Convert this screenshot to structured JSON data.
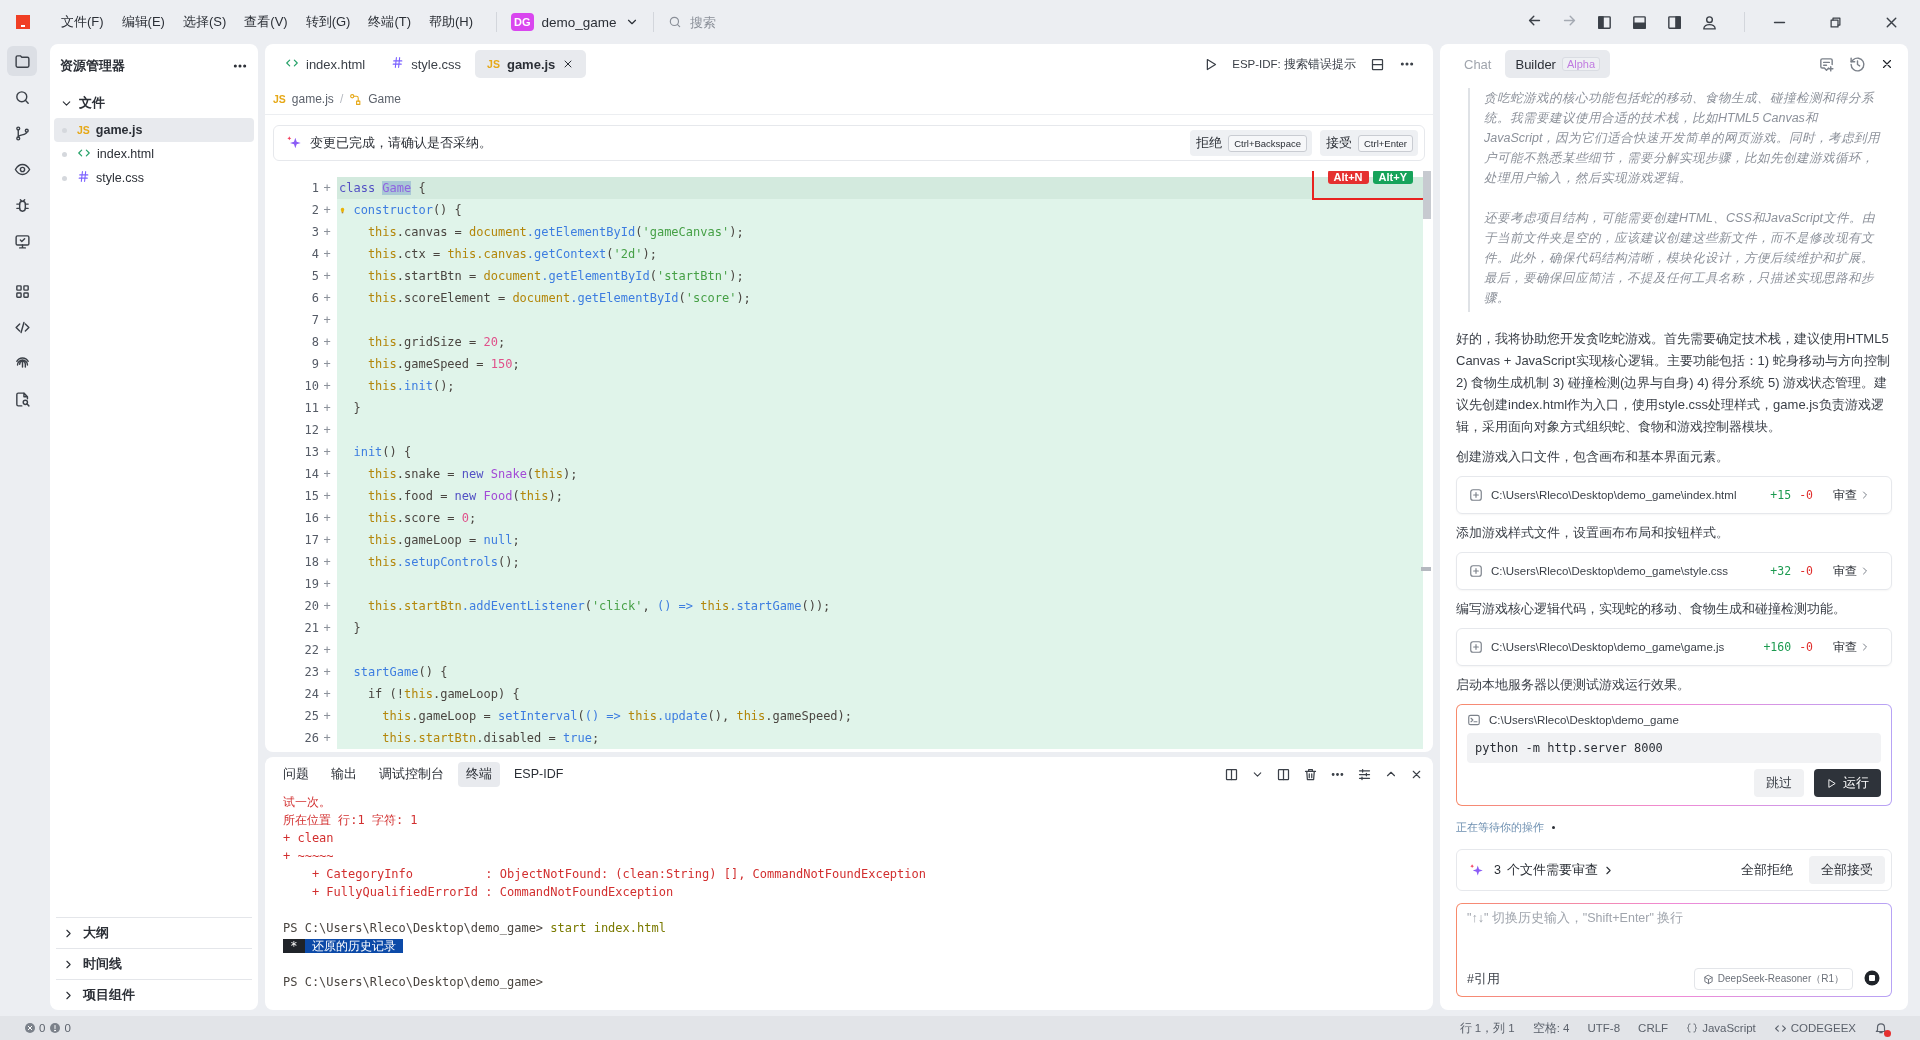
{
  "menu_bar": {
    "items": [
      "文件(F)",
      "编辑(E)",
      "选择(S)",
      "查看(V)",
      "转到(G)",
      "终端(T)",
      "帮助(H)"
    ],
    "project": {
      "badge": "DG",
      "name": "demo_game"
    },
    "search": {
      "placeholder": "搜索"
    },
    "history": {
      "back_enabled": true,
      "forward_enabled": false
    }
  },
  "activity_bar": [
    {
      "selected": true
    },
    {
      "selected": false
    },
    {
      "selected": false
    },
    {
      "selected": false
    },
    {
      "selected": false
    },
    {
      "selected": false
    },
    {
      "selected": false
    },
    {
      "selected": false
    },
    {
      "selected": false
    },
    {
      "selected": false
    }
  ],
  "explorer": {
    "title": "资源管理器",
    "files_section": {
      "label": "文件",
      "expanded": true,
      "files": [
        {
          "name": "game.js",
          "kind": "js",
          "badge": "JS",
          "selected": true
        },
        {
          "name": "index.html",
          "kind": "html",
          "selected": false
        },
        {
          "name": "style.css",
          "kind": "css",
          "selected": false
        }
      ]
    },
    "sections": [
      {
        "label": "大纲",
        "expanded": false
      },
      {
        "label": "时间线",
        "expanded": false
      },
      {
        "label": "项目组件",
        "expanded": false
      }
    ]
  },
  "editor": {
    "tabs": [
      {
        "label": "index.html",
        "kind": "html",
        "selected": false
      },
      {
        "label": "style.css",
        "kind": "css",
        "selected": false
      },
      {
        "label": "game.js",
        "kind": "js",
        "badge": "JS",
        "selected": true
      }
    ],
    "toolbar_label": "ESP-IDF: 搜索错误提示",
    "breadcrumb": {
      "file_badge": "JS",
      "file": "game.js",
      "separator": "/",
      "symbol": "Game"
    },
    "diff_banner": {
      "message": "变更已完成，请确认是否采纳。",
      "reject": {
        "label": "拒绝",
        "shortcut": "Ctrl+Backspace"
      },
      "accept": {
        "label": "接受",
        "shortcut": "Ctrl+Enter"
      }
    },
    "shortcut_badges": [
      {
        "text": "Alt+N",
        "kind": "reject"
      },
      {
        "text": "Alt+Y",
        "kind": "accept"
      }
    ],
    "lines": [
      {
        "num": "1",
        "marker": "+",
        "current": true,
        "hint": false,
        "tokens": [
          {
            "kind": "kw",
            "text": "class "
          },
          {
            "kind": "sel",
            "text": "Game"
          },
          {
            "kind": "p",
            "text": " {"
          }
        ]
      },
      {
        "num": "2",
        "marker": "+",
        "current": false,
        "hint": true,
        "tokens": [
          {
            "kind": "fn",
            "text": " constructor"
          },
          {
            "kind": "p",
            "text": "() {"
          }
        ]
      },
      {
        "num": "3",
        "marker": "+",
        "current": false,
        "hint": false,
        "tokens": [
          {
            "kind": "th",
            "text": "    this"
          },
          {
            "kind": "p",
            "text": ".canvas = "
          },
          {
            "kind": "th",
            "text": "document"
          },
          {
            "kind": "fn",
            "text": ".getElementById"
          },
          {
            "kind": "p",
            "text": "("
          },
          {
            "kind": "str",
            "text": "'gameCanvas'"
          },
          {
            "kind": "p",
            "text": ");"
          }
        ]
      },
      {
        "num": "4",
        "marker": "+",
        "current": false,
        "hint": false,
        "tokens": [
          {
            "kind": "th",
            "text": "    this"
          },
          {
            "kind": "p",
            "text": ".ctx = "
          },
          {
            "kind": "th",
            "text": "this.canvas"
          },
          {
            "kind": "fn",
            "text": ".getContext"
          },
          {
            "kind": "p",
            "text": "("
          },
          {
            "kind": "str",
            "text": "'2d'"
          },
          {
            "kind": "p",
            "text": ");"
          }
        ]
      },
      {
        "num": "5",
        "marker": "+",
        "current": false,
        "hint": false,
        "tokens": [
          {
            "kind": "th",
            "text": "    this"
          },
          {
            "kind": "p",
            "text": ".startBtn = "
          },
          {
            "kind": "th",
            "text": "document"
          },
          {
            "kind": "fn",
            "text": ".getElementById"
          },
          {
            "kind": "p",
            "text": "("
          },
          {
            "kind": "str",
            "text": "'startBtn'"
          },
          {
            "kind": "p",
            "text": ");"
          }
        ]
      },
      {
        "num": "6",
        "marker": "+",
        "current": false,
        "hint": false,
        "tokens": [
          {
            "kind": "th",
            "text": "    this"
          },
          {
            "kind": "p",
            "text": ".scoreElement = "
          },
          {
            "kind": "th",
            "text": "document"
          },
          {
            "kind": "fn",
            "text": ".getElementById"
          },
          {
            "kind": "p",
            "text": "("
          },
          {
            "kind": "str",
            "text": "'score'"
          },
          {
            "kind": "p",
            "text": ");"
          }
        ]
      },
      {
        "num": "7",
        "marker": "+",
        "current": false,
        "hint": false
      },
      {
        "num": "8",
        "marker": "+",
        "current": false,
        "hint": false,
        "tokens": [
          {
            "kind": "th",
            "text": "    this"
          },
          {
            "kind": "p",
            "text": ".gridSize = "
          },
          {
            "kind": "num",
            "text": "20"
          },
          {
            "kind": "p",
            "text": ";"
          }
        ]
      },
      {
        "num": "9",
        "marker": "+",
        "current": false,
        "hint": false,
        "tokens": [
          {
            "kind": "th",
            "text": "    this"
          },
          {
            "kind": "p",
            "text": ".gameSpeed = "
          },
          {
            "kind": "num",
            "text": "150"
          },
          {
            "kind": "p",
            "text": ";"
          }
        ]
      },
      {
        "num": "10",
        "marker": "+",
        "current": false,
        "hint": false,
        "tokens": [
          {
            "kind": "th",
            "text": "    this"
          },
          {
            "kind": "fn",
            "text": ".init"
          },
          {
            "kind": "p",
            "text": "();"
          }
        ]
      },
      {
        "num": "11",
        "marker": "+",
        "current": false,
        "hint": false,
        "tokens": [
          {
            "kind": "p",
            "text": "  }"
          }
        ]
      },
      {
        "num": "12",
        "marker": "+",
        "current": false,
        "hint": false
      },
      {
        "num": "13",
        "marker": "+",
        "current": false,
        "hint": false,
        "tokens": [
          {
            "kind": "fn",
            "text": "  init"
          },
          {
            "kind": "p",
            "text": "() {"
          }
        ]
      },
      {
        "num": "14",
        "marker": "+",
        "current": false,
        "hint": false,
        "tokens": [
          {
            "kind": "th",
            "text": "    this"
          },
          {
            "kind": "p",
            "text": ".snake = "
          },
          {
            "kind": "kw",
            "text": "new "
          },
          {
            "kind": "cls",
            "text": "Snake"
          },
          {
            "kind": "p",
            "text": "("
          },
          {
            "kind": "th",
            "text": "this"
          },
          {
            "kind": "p",
            "text": ");"
          }
        ]
      },
      {
        "num": "15",
        "marker": "+",
        "current": false,
        "hint": false,
        "tokens": [
          {
            "kind": "th",
            "text": "    this"
          },
          {
            "kind": "p",
            "text": ".food = "
          },
          {
            "kind": "kw",
            "text": "new "
          },
          {
            "kind": "cls",
            "text": "Food"
          },
          {
            "kind": "p",
            "text": "("
          },
          {
            "kind": "th",
            "text": "this"
          },
          {
            "kind": "p",
            "text": ");"
          }
        ]
      },
      {
        "num": "16",
        "marker": "+",
        "current": false,
        "hint": false,
        "tokens": [
          {
            "kind": "th",
            "text": "    this"
          },
          {
            "kind": "p",
            "text": ".score = "
          },
          {
            "kind": "num",
            "text": "0"
          },
          {
            "kind": "p",
            "text": ";"
          }
        ]
      },
      {
        "num": "17",
        "marker": "+",
        "current": false,
        "hint": false,
        "tokens": [
          {
            "kind": "th",
            "text": "    this"
          },
          {
            "kind": "p",
            "text": ".gameLoop = "
          },
          {
            "kind": "lit",
            "text": "null"
          },
          {
            "kind": "p",
            "text": ";"
          }
        ]
      },
      {
        "num": "18",
        "marker": "+",
        "current": false,
        "hint": false,
        "tokens": [
          {
            "kind": "th",
            "text": "    this"
          },
          {
            "kind": "fn",
            "text": ".setupControls"
          },
          {
            "kind": "p",
            "text": "();"
          }
        ]
      },
      {
        "num": "19",
        "marker": "+",
        "current": false,
        "hint": false
      },
      {
        "num": "20",
        "marker": "+",
        "current": false,
        "hint": false,
        "tokens": [
          {
            "kind": "th",
            "text": "    this.startBtn"
          },
          {
            "kind": "fn",
            "text": ".addEventListener"
          },
          {
            "kind": "p",
            "text": "("
          },
          {
            "kind": "str",
            "text": "'click'"
          },
          {
            "kind": "p",
            "text": ", "
          },
          {
            "kind": "lit",
            "text": "() => "
          },
          {
            "kind": "th",
            "text": "this"
          },
          {
            "kind": "fn",
            "text": ".startGame"
          },
          {
            "kind": "p",
            "text": "());"
          }
        ]
      },
      {
        "num": "21",
        "marker": "+",
        "current": false,
        "hint": false,
        "tokens": [
          {
            "kind": "p",
            "text": "  }"
          }
        ]
      },
      {
        "num": "22",
        "marker": "+",
        "current": false,
        "hint": false
      },
      {
        "num": "23",
        "marker": "+",
        "current": false,
        "hint": false,
        "tokens": [
          {
            "kind": "fn",
            "text": "  startGame"
          },
          {
            "kind": "p",
            "text": "() {"
          }
        ]
      },
      {
        "num": "24",
        "marker": "+",
        "current": false,
        "hint": false,
        "tokens": [
          {
            "kind": "p",
            "text": "    if (!"
          },
          {
            "kind": "th",
            "text": "this"
          },
          {
            "kind": "p",
            "text": ".gameLoop) {"
          }
        ]
      },
      {
        "num": "25",
        "marker": "+",
        "current": false,
        "hint": false,
        "tokens": [
          {
            "kind": "th",
            "text": "      this"
          },
          {
            "kind": "p",
            "text": ".gameLoop = "
          },
          {
            "kind": "fn",
            "text": "setInterval"
          },
          {
            "kind": "p",
            "text": "("
          },
          {
            "kind": "lit",
            "text": "() => "
          },
          {
            "kind": "th",
            "text": "this"
          },
          {
            "kind": "fn",
            "text": ".update"
          },
          {
            "kind": "p",
            "text": "(), "
          },
          {
            "kind": "th",
            "text": "this"
          },
          {
            "kind": "p",
            "text": ".gameSpeed);"
          }
        ]
      },
      {
        "num": "26",
        "marker": "+",
        "current": false,
        "hint": false,
        "tokens": [
          {
            "kind": "th",
            "text": "      this.startBtn"
          },
          {
            "kind": "p",
            "text": ".disabled = "
          },
          {
            "kind": "lit",
            "text": "true"
          },
          {
            "kind": "p",
            "text": ";"
          }
        ]
      }
    ]
  },
  "panel": {
    "tabs": [
      {
        "label": "问题",
        "selected": false
      },
      {
        "label": "输出",
        "selected": false
      },
      {
        "label": "调试控制台",
        "selected": false
      },
      {
        "label": "终端",
        "selected": true
      },
      {
        "label": "ESP-IDF",
        "selected": false
      }
    ],
    "terminal": [
      {
        "kind": "line",
        "tokens": [
          {
            "kind": "err",
            "text": "试一次。"
          }
        ]
      },
      {
        "kind": "line",
        "tokens": [
          {
            "kind": "err",
            "text": "所在位置 行:1 字符: 1"
          }
        ]
      },
      {
        "kind": "line",
        "tokens": [
          {
            "kind": "err",
            "text": "+ clean"
          }
        ]
      },
      {
        "kind": "line",
        "tokens": [
          {
            "kind": "err",
            "text": "+ ~~~~~"
          }
        ]
      },
      {
        "kind": "line",
        "tokens": [
          {
            "kind": "err",
            "text": "    + CategoryInfo          : ObjectNotFound: (clean:String) [], CommandNotFoundException"
          }
        ]
      },
      {
        "kind": "line",
        "tokens": [
          {
            "kind": "err",
            "text": "    + FullyQualifiedErrorId : CommandNotFoundException"
          }
        ]
      },
      {
        "kind": "blank"
      },
      {
        "kind": "line",
        "tokens": [
          {
            "kind": "p",
            "text": "PS C:\\Users\\Rleco\\Desktop\\demo_game> "
          },
          {
            "kind": "cmd",
            "text": "start index.html"
          }
        ]
      },
      {
        "kind": "line",
        "tokens": [
          {
            "kind": "mark",
            "text": " * "
          },
          {
            "kind": "hl",
            "text": " 还原的历史记录 "
          }
        ]
      },
      {
        "kind": "blank"
      },
      {
        "kind": "line",
        "tokens": [
          {
            "kind": "p",
            "text": "PS C:\\Users\\Rleco\\Desktop\\demo_game>"
          }
        ]
      }
    ]
  },
  "assistant": {
    "tabs": [
      {
        "label": "Chat",
        "selected": false
      },
      {
        "label": "Builder",
        "badge": "Alpha",
        "selected": true
      }
    ],
    "reasoning": [
      "贪吃蛇游戏的核心功能包括蛇的移动、食物生成、碰撞检测和得分系统。我需要建议使用合适的技术栈，比如HTML5 Canvas和JavaScript，因为它们适合快速开发简单的网页游戏。同时，考虑到用户可能不熟悉某些细节，需要分解实现步骤，比如先创建游戏循环，处理用户输入，然后实现游戏逻辑。",
      "还要考虑项目结构，可能需要创建HTML、CSS和JavaScript文件。由于当前文件夹是空的，应该建议创建这些新文件，而不是修改现有文件。此外，确保代码结构清晰，模块化设计，方便后续维护和扩展。最后，要确保回应简洁，不提及任何工具名称，只描述实现思路和步骤。"
    ],
    "answer": "好的，我将协助您开发贪吃蛇游戏。首先需要确定技术栈，建议使用HTML5 Canvas + JavaScript实现核心逻辑。主要功能包括：1) 蛇身移动与方向控制 2) 食物生成机制 3) 碰撞检测(边界与自身) 4) 得分系统 5) 游戏状态管理。建议先创建index.html作为入口，使用style.css处理样式，game.js负责游戏逻辑，采用面向对象方式组织蛇、食物和游戏控制器模块。",
    "steps": [
      {
        "kind": "file",
        "text": "创建游戏入口文件，包含画布和基本界面元素。",
        "path": "C:\\Users\\Rleco\\Desktop\\demo_game\\index.html",
        "added": "+15",
        "removed": "-0",
        "action": "审查"
      },
      {
        "kind": "file",
        "text": "添加游戏样式文件，设置画布布局和按钮样式。",
        "path": "C:\\Users\\Rleco\\Desktop\\demo_game\\style.css",
        "added": "+32",
        "removed": "-0",
        "action": "审查"
      },
      {
        "kind": "file",
        "text": "编写游戏核心逻辑代码，实现蛇的移动、食物生成和碰撞检测功能。",
        "path": "C:\\Users\\Rleco\\Desktop\\demo_game\\game.js",
        "added": "+160",
        "removed": "-0",
        "action": "审查"
      },
      {
        "kind": "command",
        "text": "启动本地服务器以便测试游戏运行效果。",
        "cwd": "C:\\Users\\Rleco\\Desktop\\demo_game",
        "command": "python -m http.server 8000",
        "skip": "跳过",
        "run": "运行"
      }
    ],
    "status": "正在等待你的操作",
    "review": {
      "count": "3",
      "text": "个文件需要审查",
      "reject_all": "全部拒绝",
      "accept_all": "全部接受"
    },
    "input": {
      "placeholder": "\"↑↓\" 切换历史输入，\"Shift+Enter\" 换行",
      "reference": "#引用",
      "model": "DeepSeek-Reasoner（R1）"
    }
  },
  "status_bar": {
    "errors": "0",
    "warnings": "0",
    "items": [
      {
        "kind": "plain",
        "text": "行 1，列 1"
      },
      {
        "kind": "plain",
        "text": "空格: 4"
      },
      {
        "kind": "plain",
        "text": "UTF-8"
      },
      {
        "kind": "plain",
        "text": "CRLF"
      },
      {
        "kind": "language",
        "text": "JavaScript"
      },
      {
        "kind": "plugin",
        "text": "CODEGEEX"
      }
    ],
    "unread_notifications": true
  }
}
